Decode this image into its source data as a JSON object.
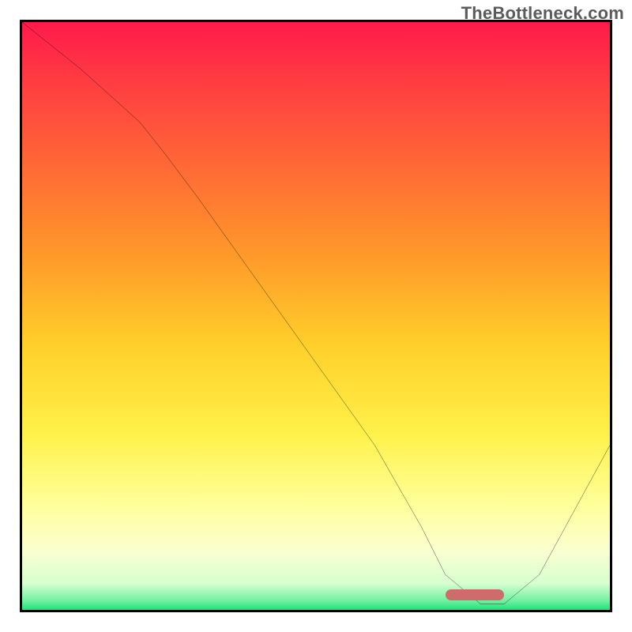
{
  "watermark": "TheBottleneck.com",
  "chart_data": {
    "type": "line",
    "title": "",
    "xlabel": "",
    "ylabel": "",
    "xlim": [
      0,
      100
    ],
    "ylim": [
      0,
      100
    ],
    "x": [
      0,
      10,
      20,
      24,
      30,
      40,
      50,
      60,
      68,
      72,
      78,
      82,
      88,
      100
    ],
    "values": [
      100,
      92,
      83,
      78,
      70,
      56,
      42,
      28,
      14,
      6,
      1,
      1,
      6,
      28
    ],
    "optimal_range_x": [
      72,
      82
    ],
    "marker_color": "#cf6a6d",
    "curve_color": "#000000",
    "gradient_stops": [
      {
        "offset": 0.0,
        "color": "#ff1a4b"
      },
      {
        "offset": 0.1,
        "color": "#ff3c42"
      },
      {
        "offset": 0.25,
        "color": "#ff6a35"
      },
      {
        "offset": 0.4,
        "color": "#ff9a2a"
      },
      {
        "offset": 0.55,
        "color": "#ffcf2a"
      },
      {
        "offset": 0.7,
        "color": "#fff14a"
      },
      {
        "offset": 0.82,
        "color": "#ffff9a"
      },
      {
        "offset": 0.9,
        "color": "#faffd0"
      },
      {
        "offset": 0.955,
        "color": "#d7ffd0"
      },
      {
        "offset": 0.985,
        "color": "#6ef0a0"
      },
      {
        "offset": 1.0,
        "color": "#20e07a"
      }
    ]
  }
}
